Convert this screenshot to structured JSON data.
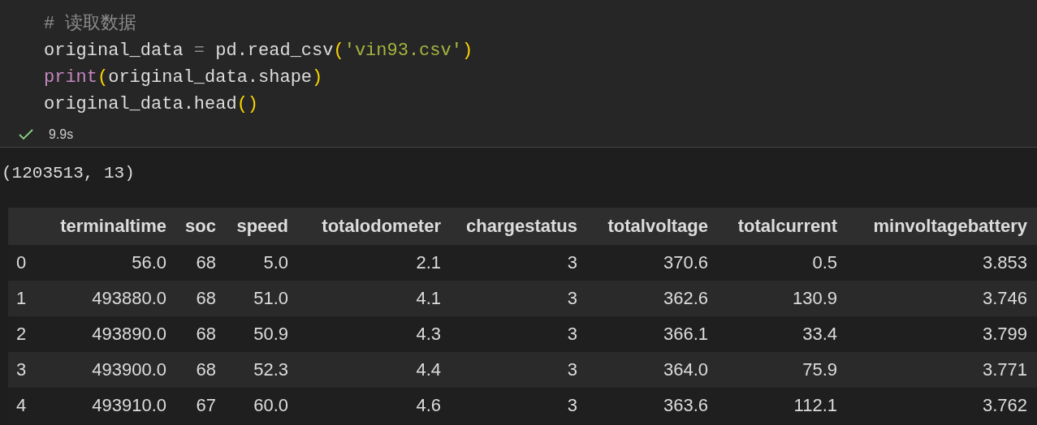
{
  "code_cell": {
    "lines": [
      [
        {
          "kind": "comment",
          "text": "# 读取数据"
        }
      ],
      [
        {
          "kind": "name",
          "text": "original_data "
        },
        {
          "kind": "op",
          "text": "="
        },
        {
          "kind": "name",
          "text": " pd.read_csv"
        },
        {
          "kind": "paren",
          "text": "("
        },
        {
          "kind": "string",
          "text": "'vin93.csv'"
        },
        {
          "kind": "paren",
          "text": ")"
        }
      ],
      [
        {
          "kind": "keyword",
          "text": "print"
        },
        {
          "kind": "paren",
          "text": "("
        },
        {
          "kind": "name",
          "text": "original_data.shape"
        },
        {
          "kind": "paren",
          "text": ")"
        }
      ],
      [
        {
          "kind": "name",
          "text": "original_data.head"
        },
        {
          "kind": "paren",
          "text": "()"
        }
      ]
    ],
    "status": {
      "success": true,
      "duration": "9.9s"
    }
  },
  "output": {
    "text": "(1203513, 13)",
    "table": {
      "columns": [
        "",
        "terminaltime",
        "soc",
        "speed",
        "totalodometer",
        "chargestatus",
        "totalvoltage",
        "totalcurrent",
        "minvoltagebattery"
      ],
      "rows": [
        [
          "0",
          "56.0",
          "68",
          "5.0",
          "2.1",
          "3",
          "370.6",
          "0.5",
          "3.853"
        ],
        [
          "1",
          "493880.0",
          "68",
          "51.0",
          "4.1",
          "3",
          "362.6",
          "130.9",
          "3.746"
        ],
        [
          "2",
          "493890.0",
          "68",
          "50.9",
          "4.3",
          "3",
          "366.1",
          "33.4",
          "3.799"
        ],
        [
          "3",
          "493900.0",
          "68",
          "52.3",
          "4.4",
          "3",
          "364.0",
          "75.9",
          "3.771"
        ],
        [
          "4",
          "493910.0",
          "67",
          "60.0",
          "4.6",
          "3",
          "363.6",
          "112.1",
          "3.762"
        ]
      ]
    }
  }
}
